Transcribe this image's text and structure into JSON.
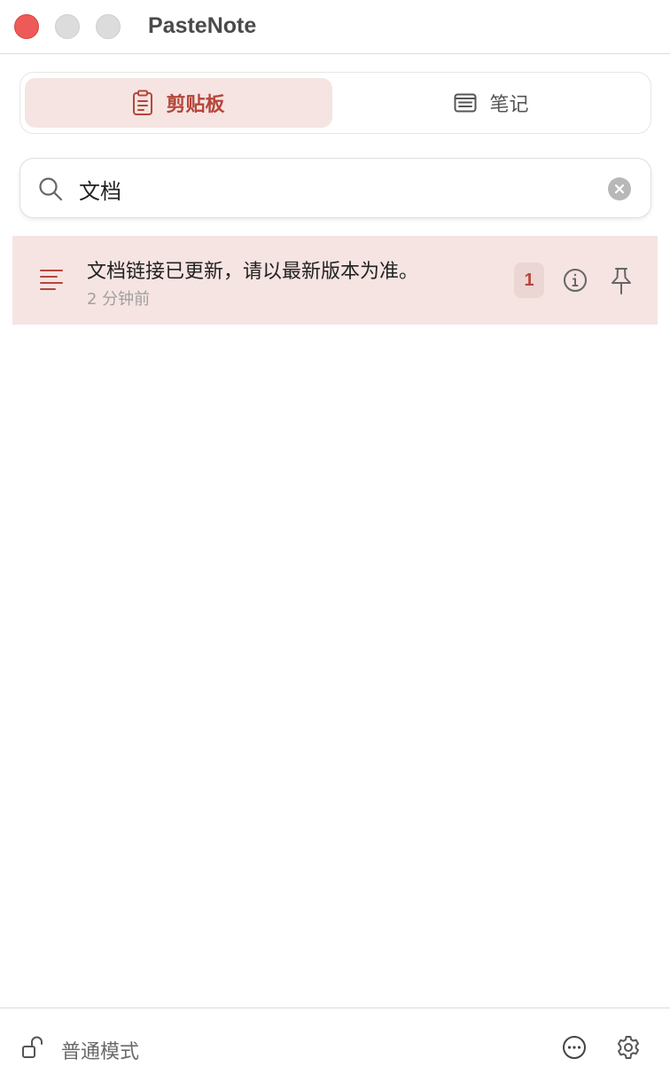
{
  "app": {
    "title": "PasteNote"
  },
  "tabs": [
    {
      "label": "剪贴板",
      "icon": "clipboard-icon",
      "active": true
    },
    {
      "label": "笔记",
      "icon": "note-icon",
      "active": false
    }
  ],
  "search": {
    "value": "文档",
    "placeholder": ""
  },
  "list": {
    "items": [
      {
        "title": "文档链接已更新，请以最新版本为准。",
        "time": "2 分钟前",
        "count": "1",
        "icon": "text-lines-icon"
      }
    ]
  },
  "footer": {
    "mode_label": "普通模式"
  },
  "colors": {
    "accent": "#b5463a",
    "selected_bg": "#f5e4e2",
    "close_button": "#ee5a57"
  }
}
